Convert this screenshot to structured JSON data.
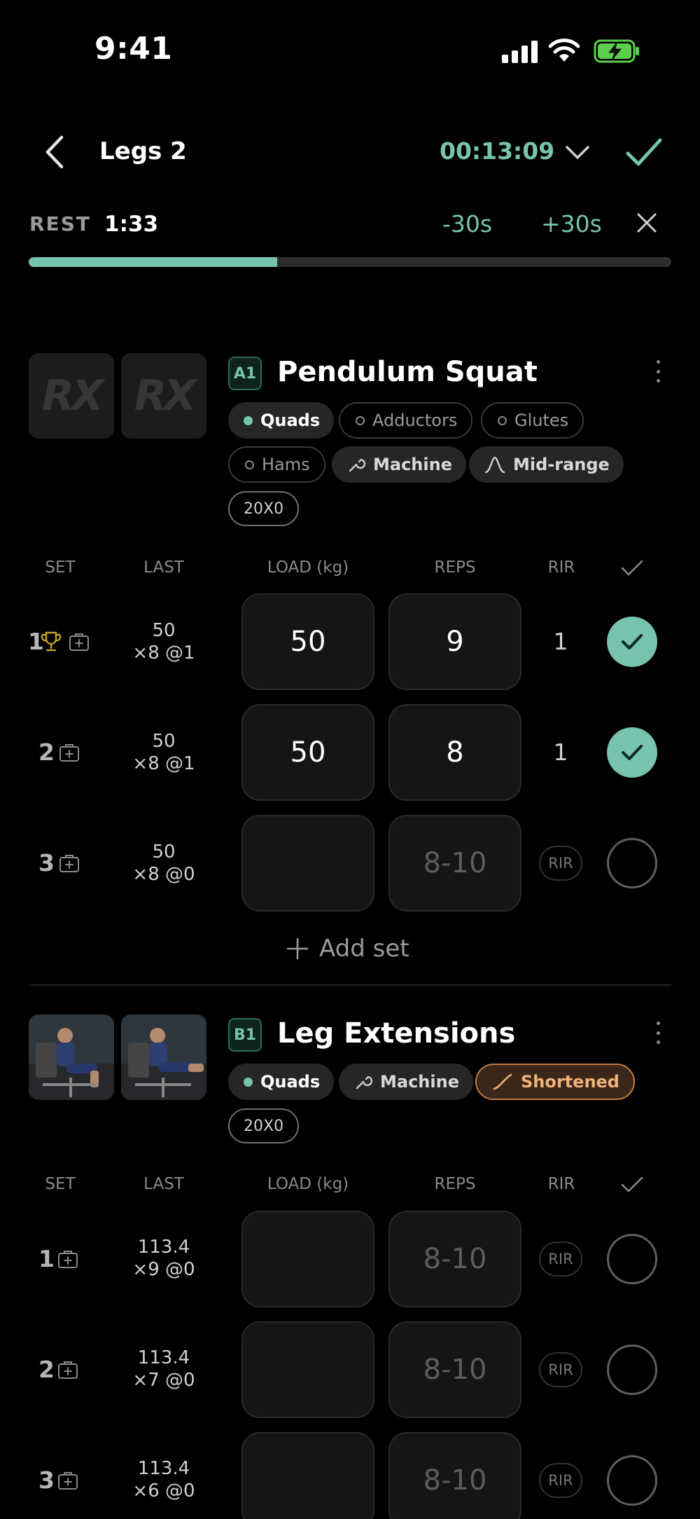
{
  "status_bar": {
    "time": "9:41"
  },
  "header": {
    "title": "Legs 2",
    "timer": "00:13:09"
  },
  "rest": {
    "label": "REST",
    "time": "1:33",
    "minus_label": "-30s",
    "plus_label": "+30s",
    "progress": 0.387
  },
  "columns": {
    "set": "SET",
    "last": "LAST",
    "load": "LOAD (kg)",
    "reps": "REPS",
    "rir": "RIR"
  },
  "exercises": [
    {
      "badge": "A1",
      "name": "Pendulum Squat",
      "thumb_text": "RX",
      "chips": [
        {
          "label": "Quads",
          "icon": "filled-dot"
        },
        {
          "label": "Adductors",
          "icon": "ring-dot"
        },
        {
          "label": "Glutes",
          "icon": "ring-dot"
        },
        {
          "label": "Hams",
          "icon": "ring-dot"
        },
        {
          "label": "Machine",
          "icon": "wrench-icon"
        },
        {
          "label": "Mid-range",
          "icon": "peak-curve-icon"
        }
      ],
      "tempo": "20X0",
      "sets": [
        {
          "num": "1",
          "last_load": "50",
          "last_detail": "×8 @1",
          "load": "50",
          "reps": "9",
          "rir": "1",
          "done": true,
          "pr": true
        },
        {
          "num": "2",
          "last_load": "50",
          "last_detail": "×8 @1",
          "load": "50",
          "reps": "8",
          "rir": "1",
          "done": true
        },
        {
          "num": "3",
          "last_load": "50",
          "last_detail": "×8 @0",
          "load": "",
          "reps_placeholder": "8-10",
          "rir_placeholder": "RIR",
          "done": false
        }
      ],
      "add_set_label": "Add set"
    },
    {
      "badge": "B1",
      "name": "Leg Extensions",
      "chips": [
        {
          "label": "Quads",
          "icon": "filled-dot"
        },
        {
          "label": "Machine",
          "icon": "wrench-icon"
        },
        {
          "label": "Shortened",
          "icon": "rising-curve-icon",
          "color": "#c07d44"
        }
      ],
      "tempo": "20X0",
      "sets": [
        {
          "num": "1",
          "last_load": "113.4",
          "last_detail": "×9 @0",
          "reps_placeholder": "8-10",
          "rir_placeholder": "RIR",
          "done": false
        },
        {
          "num": "2",
          "last_load": "113.4",
          "last_detail": "×7 @0",
          "reps_placeholder": "8-10",
          "rir_placeholder": "RIR",
          "done": false
        },
        {
          "num": "3",
          "last_load": "113.4",
          "last_detail": "×6 @0",
          "reps_placeholder": "8-10",
          "rir_placeholder": "RIR",
          "done": false
        }
      ]
    }
  ],
  "colors": {
    "accent": "#78c3ad",
    "background": "#000000",
    "shortened": "#c07d44"
  }
}
